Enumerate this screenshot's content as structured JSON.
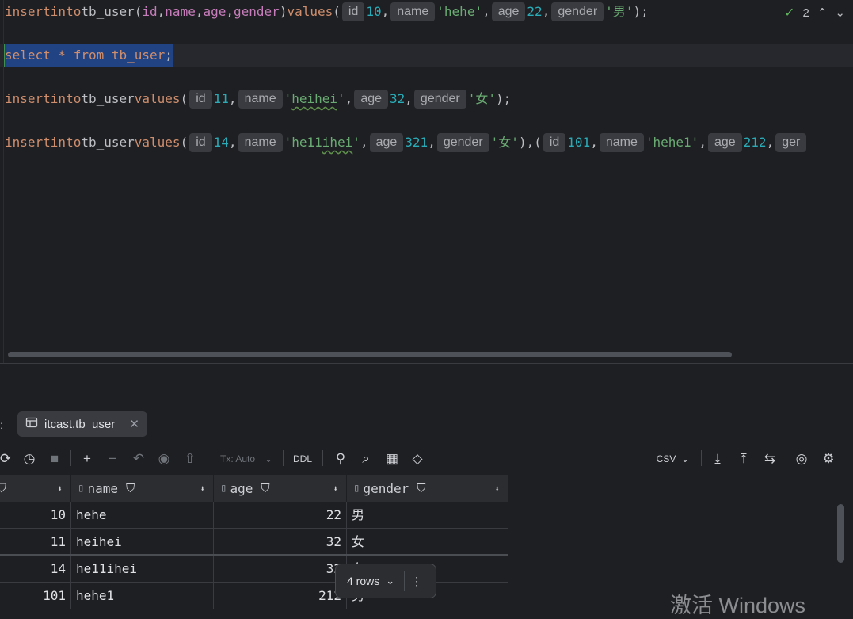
{
  "editor": {
    "lines": {
      "l1": {
        "kw_insert": "insert",
        "kw_into": "into",
        "table": "tb_user(",
        "c_id": "id",
        "c_name": "name",
        "c_age": "age",
        "c_gender": "gender",
        "comma": ",",
        "close": ")",
        "kw_values": "values",
        "open": "(",
        "h_id": "id",
        "v_id": "10",
        "h_name": "name",
        "v_name": "'hehe'",
        "h_age": "age",
        "v_age": "22",
        "h_gender": "gender",
        "v_gender": "'男'",
        "end": ");"
      },
      "l2": {
        "text": "select * from tb_user",
        "end": ";"
      },
      "l3": {
        "kw_insert": "insert",
        "kw_into": "into",
        "table": "tb_user",
        "kw_values": "values",
        "open": "(",
        "h_id": "id",
        "v_id": "11",
        "h_name": "name",
        "v_name_q1": "'",
        "v_name_w": "heihei",
        "v_name_q2": "'",
        "h_age": "age",
        "v_age": "32",
        "h_gender": "gender",
        "v_gender": "'女'",
        "end": ");"
      },
      "l4": {
        "kw_insert": "insert",
        "kw_into": "into",
        "table": "tb_user",
        "kw_values": "values",
        "open": "(",
        "h_id": "id",
        "v_id": "14",
        "h_name": "name",
        "v_name_a": "'he11",
        "v_name_w": "ihei",
        "v_name_b": "'",
        "h_age": "age",
        "v_age": "321",
        "h_gender": "gender",
        "v_gender": "'女'",
        "mid": "),(",
        "h_id2": "id",
        "v_id2": "101",
        "h_name2": "name",
        "v_name2": "'hehe1'",
        "h_age2": "age",
        "v_age2": "212",
        "h_gender2": "ger"
      }
    },
    "inspection": {
      "icon": "check-double-icon",
      "count": "2",
      "up": "⌃",
      "down": "⌄"
    }
  },
  "services": {
    "tab_label": "itcast.tb_user",
    "tab_close": "✕",
    "toolbar": {
      "tx_mode": "Tx: Auto",
      "ddl": "DDL",
      "export_format": "CSV"
    },
    "grid": {
      "columns": [
        "name",
        "age",
        "gender"
      ],
      "rows": [
        {
          "id": "10",
          "name": "hehe",
          "age": "22",
          "gender": "男"
        },
        {
          "id": "11",
          "name": "heihei",
          "age": "32",
          "gender": "女"
        },
        {
          "id": "14",
          "name": "he11ihei",
          "age": "32",
          "gender": "女"
        },
        {
          "id": "101",
          "name": "hehe1",
          "age": "212",
          "gender": "男"
        }
      ]
    },
    "rows_pill": {
      "label": "4 rows",
      "more": "⋮"
    }
  },
  "watermark": "激活 Windows",
  "colors": {
    "keyword": "#cf8e6d",
    "column": "#c77dbb",
    "number": "#2aacb8",
    "string": "#6aab73",
    "selection": "#214283"
  }
}
